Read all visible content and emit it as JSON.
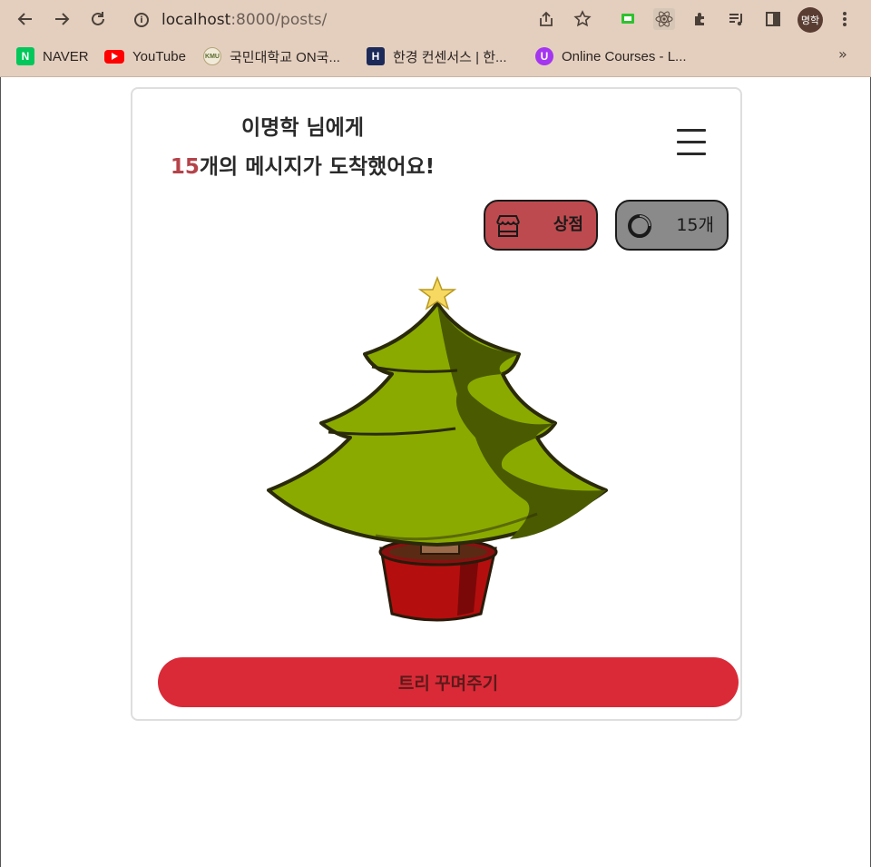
{
  "browser": {
    "url_host": "localhost",
    "url_port_path": ":8000/posts/",
    "profile_initials": "명학",
    "bookmarks": [
      {
        "label": "NAVER",
        "icon": "naver-icon",
        "color": "#03c75a"
      },
      {
        "label": "YouTube",
        "icon": "youtube-icon",
        "color": "#ff0000"
      },
      {
        "label": "국민대학교 ON국...",
        "icon": "kmu-icon",
        "color": "#d9c9a0"
      },
      {
        "label": "한경 컨센서스 | 한...",
        "icon": "hankyung-icon",
        "color": "#1c2a5a"
      },
      {
        "label": "Online Courses - L...",
        "icon": "udemy-icon",
        "color": "#a435f0"
      }
    ],
    "more_bookmarks": "»"
  },
  "page": {
    "recipient_line": "이명학 님에게",
    "message_count": "15",
    "message_suffix": "개의 메시지가 도착했어요!",
    "shop_label": "상점",
    "coin_label": "15개",
    "decorate_button": "트리 꾸며주기",
    "colors": {
      "shop_button": "#bd4a4e",
      "coin_button": "#8a8a8a",
      "decorate_button": "#da2a37",
      "count_accent": "#b5434a"
    }
  }
}
